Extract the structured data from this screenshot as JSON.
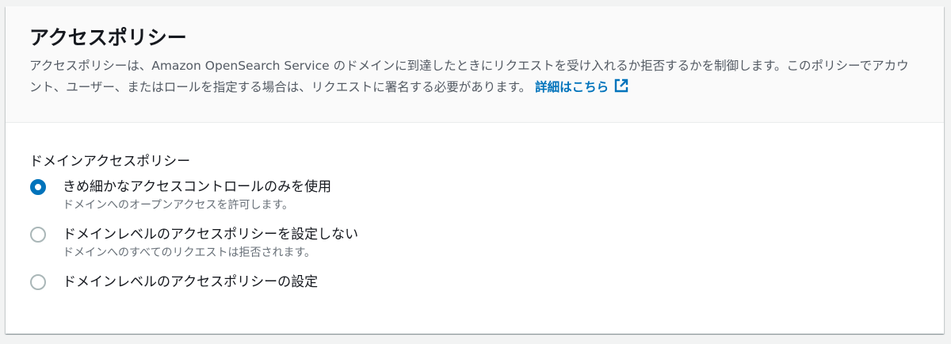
{
  "panel": {
    "title": "アクセスポリシー",
    "description": "アクセスポリシーは、Amazon OpenSearch Service のドメインに到達したときにリクエストを受け入れるか拒否するかを制御します。このポリシーでアカウント、ユーザー、またはロールを指定する場合は、リクエストに署名する必要があります。",
    "learn_more": "詳細はこちら"
  },
  "policy": {
    "label": "ドメインアクセスポリシー",
    "options": [
      {
        "label": "きめ細かなアクセスコントロールのみを使用",
        "description": "ドメインへのオープンアクセスを許可します。",
        "checked": true
      },
      {
        "label": "ドメインレベルのアクセスポリシーを設定しない",
        "description": "ドメインへのすべてのリクエストは拒否されます。",
        "checked": false
      },
      {
        "label": "ドメインレベルのアクセスポリシーの設定",
        "description": "",
        "checked": false
      }
    ]
  },
  "colors": {
    "accent": "#0073bb",
    "text": "#16191f",
    "muted": "#545b64"
  },
  "icons": {
    "learn_more": "external-link-icon"
  }
}
